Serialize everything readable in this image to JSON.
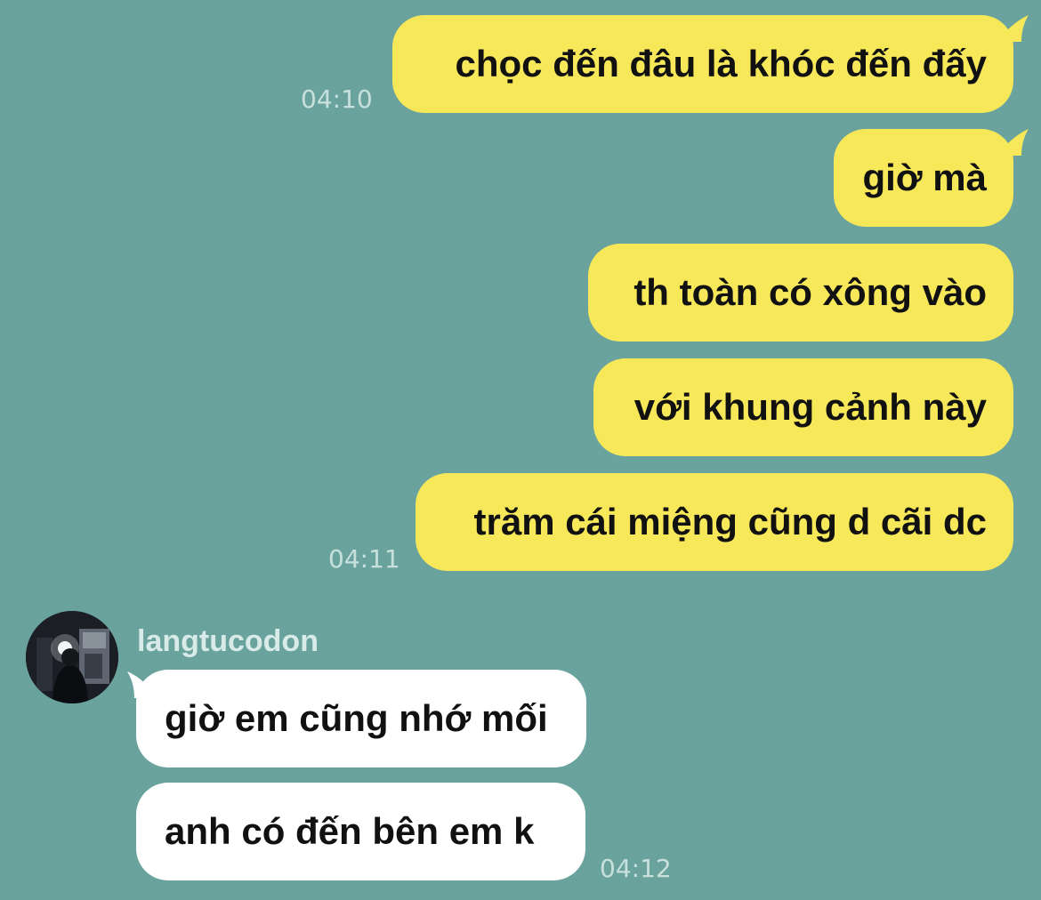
{
  "messages_out": [
    {
      "text": "chọc đến đâu là khóc đến đấy",
      "time": "04:10"
    },
    {
      "text": "giờ mà",
      "time": ""
    },
    {
      "text": "th toàn có xông vào",
      "time": ""
    },
    {
      "text": "với khung cảnh này",
      "time": ""
    },
    {
      "text": "trăm cái miệng cũng d cãi dc",
      "time": "04:11"
    }
  ],
  "incoming": {
    "sender": "langtucodon",
    "messages": [
      {
        "text": "giờ em cũng nhớ mối"
      },
      {
        "text": "anh có đến bên em k"
      }
    ],
    "time": "04:12"
  },
  "colors": {
    "background": "#6aa39d",
    "outgoing_bubble": "#f7e85a",
    "incoming_bubble": "#ffffff",
    "timestamp": "#c8e0dc"
  },
  "icons": {
    "avatar": "user-avatar-photo"
  }
}
